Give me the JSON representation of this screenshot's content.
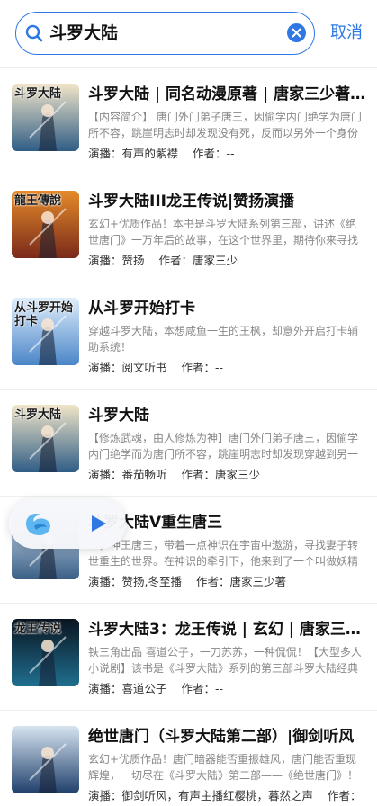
{
  "search": {
    "query": "斗罗大陆",
    "cancel_label": "取消"
  },
  "colors": {
    "accent": "#2f78e4"
  },
  "results": [
    {
      "title": "斗罗大陆 | 同名动漫原著 | 唐家三少著 | 经典...",
      "desc": "【内容简介】 唐门外门弟子唐三，因偷学内门绝学为唐门所不容，跳崖明志时却发现没有死，反而以另外一个身份来到了另一个世界",
      "narrator_label": "演播：",
      "narrator": "有声的紫襟",
      "author_label": "作者：",
      "author": "--"
    },
    {
      "title": "斗罗大陆III龙王传说|赞扬演播",
      "desc": "玄幻+优质作品！本书是斗罗大陆系列第三部，讲述《绝世唐门》一万年后的故事，在这个世界里，期待你来寻找隐藏的惊喜",
      "narrator_label": "演播：",
      "narrator": "赞扬",
      "author_label": "作者：",
      "author": "唐家三少"
    },
    {
      "title": "从斗罗开始打卡",
      "desc": "穿越斗罗大陆，本想咸鱼一生的王枫，却意外开启打卡辅助系统！",
      "narrator_label": "演播：",
      "narrator": "阅文听书",
      "author_label": "作者：",
      "author": "--"
    },
    {
      "title": "斗罗大陆",
      "desc": "【修炼武魂，由人修炼为神】唐门外门弟子唐三，因偷学内门绝学而为唐门所不容，跳崖明志时却发现穿越到另一个世界",
      "narrator_label": "演播：",
      "narrator": "番茄畅听",
      "author_label": "作者：",
      "author": "唐家三少"
    },
    {
      "title": "斗罗大陆V重生唐三",
      "desc": "…，神王唐三，带着一点神识在宇宙中遨游，寻找妻子转世重生的世界。在神识的牵引下，他来到了一个叫做妖精大陆的世界",
      "narrator_label": "演播：",
      "narrator": "赞扬,冬至播",
      "author_label": "作者：",
      "author": "唐家三少著"
    },
    {
      "title": "斗罗大陆3：龙王传说 | 玄幻 | 唐家三少著",
      "desc": "铁三角出品 喜道公子，一刀苏苏，一种侃侃！【大型多人小说剧】该书是《斗罗大陆》系列的第三部斗罗大陆经典作品",
      "narrator_label": "演播：",
      "narrator": "喜道公子",
      "author_label": "作者：",
      "author": "--"
    },
    {
      "title": "绝世唐门（斗罗大陆第二部）|御剑听风",
      "desc": "玄幻+优质作品！唐门暗器能否重振雄风，唐门能否重现辉煌，一切尽在《斗罗大陆》第二部——《绝世唐门》！",
      "narrator_label": "演播：",
      "narrator": "御剑听风，有声主播红樱桃，暮然之声",
      "author_label": "作者：",
      "author": ""
    }
  ],
  "covers": [
    {
      "icon": "cover-art",
      "text": "斗罗大陆",
      "bg": [
        "#f1e5c8",
        "#2f5d86"
      ]
    },
    {
      "icon": "cover-art",
      "text": "龍王傳說",
      "bg": [
        "#e48a2a",
        "#7a2a1a"
      ]
    },
    {
      "icon": "cover-art",
      "text": "从斗罗开始打卡",
      "bg": [
        "#dfeefc",
        "#4a85c7"
      ]
    },
    {
      "icon": "cover-art",
      "text": "斗罗大陆",
      "bg": [
        "#f1e5c8",
        "#2f5d86"
      ]
    },
    {
      "icon": "cover-art",
      "text": "",
      "bg": [
        "#cfe0ef",
        "#3a5f86"
      ]
    },
    {
      "icon": "cover-art",
      "text": "龙王传说",
      "bg": [
        "#0a1420",
        "#1f6f8f"
      ]
    },
    {
      "icon": "cover-art",
      "text": "",
      "bg": [
        "#d7e4f0",
        "#1f3f6b"
      ]
    }
  ],
  "mini_player": {
    "logo_icon": "app-logo-icon",
    "play_icon": "play-icon"
  }
}
